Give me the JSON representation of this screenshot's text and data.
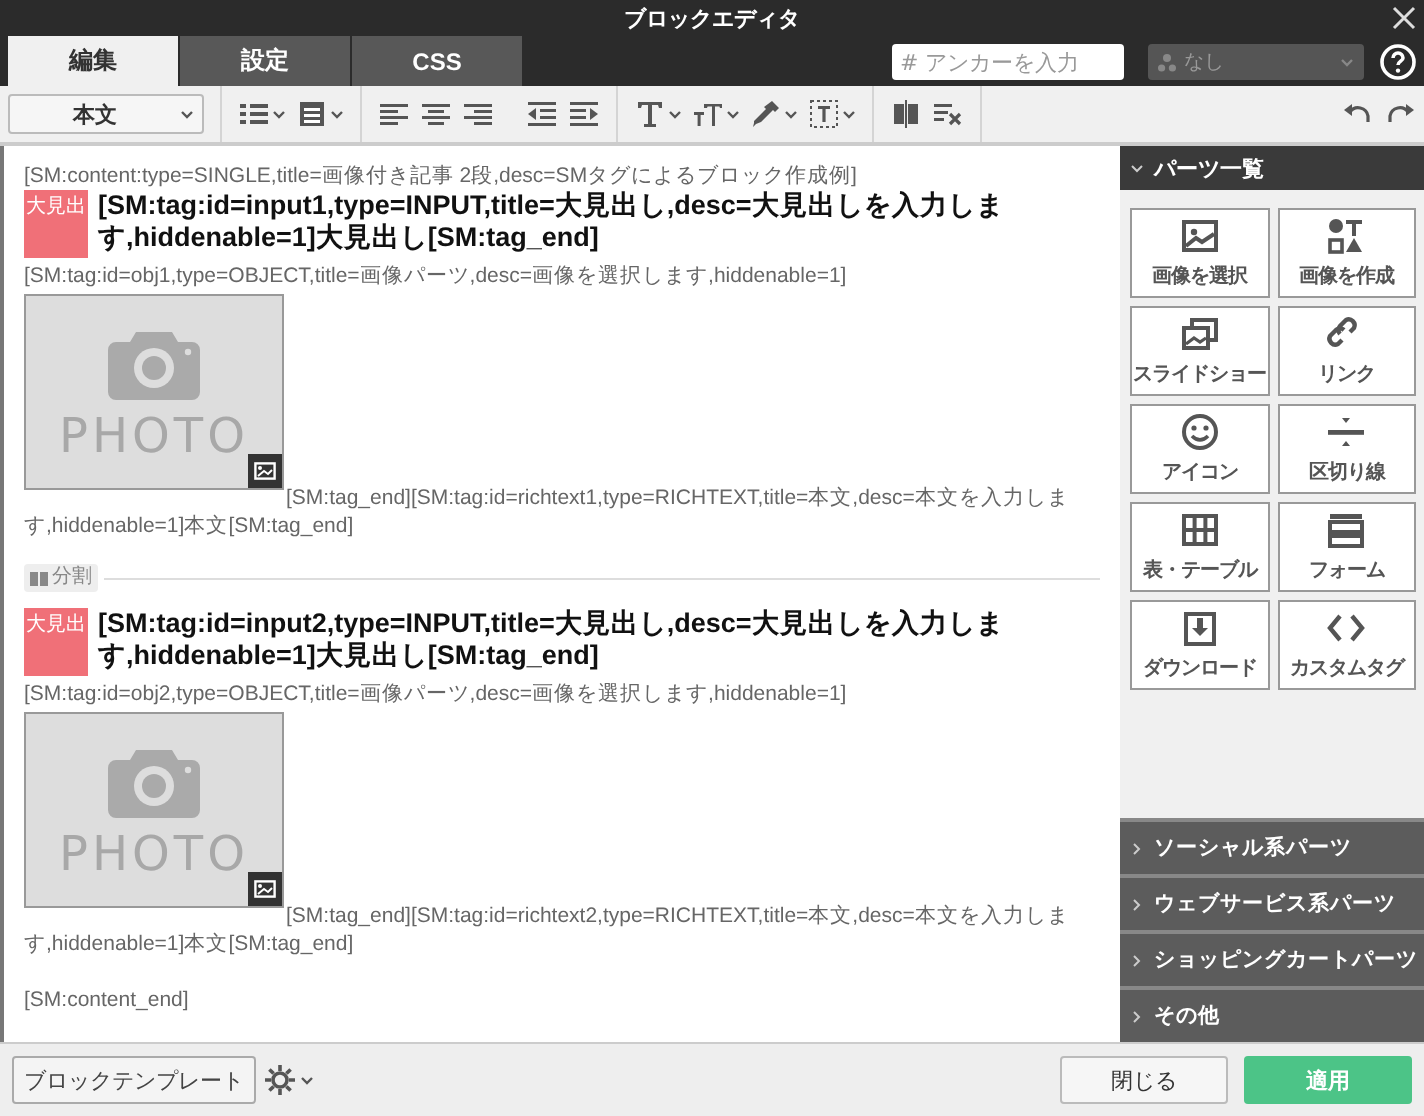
{
  "window": {
    "title": "ブロックエディタ"
  },
  "tabs": [
    {
      "label": "編集",
      "selected": true
    },
    {
      "label": "設定",
      "selected": false
    },
    {
      "label": "CSS",
      "selected": false
    }
  ],
  "anchor": {
    "placeholder": "# アンカーを入力"
  },
  "class_select": {
    "value": "なし",
    "disabled": true
  },
  "toolbar": {
    "style_select": "本文"
  },
  "editor": {
    "blocks": [
      {
        "kind": "tag",
        "text": "[SM:content:type=SINGLE,title=画像付き記事 2段,desc=SMタグによるブロック作成例]"
      },
      {
        "kind": "heading",
        "badge": "大見出",
        "text": "[SM:tag:id=input1,type=INPUT,title=大見出し,desc=大見出しを入力します,hiddenable=1]大見出し[SM:tag_end]"
      },
      {
        "kind": "tag",
        "text": "[SM:tag:id=obj1,type=OBJECT,title=画像パーツ,desc=画像を選択します,hiddenable=1]"
      },
      {
        "kind": "photo",
        "photo_label": "PHOTO",
        "text": "[SM:tag_end][SM:tag:id=richtext1,type=RICHTEXT,title=本文,desc=本文を入力します,hiddenable=1]本文[SM:tag_end]"
      },
      {
        "kind": "divider",
        "label": "分割"
      },
      {
        "kind": "heading",
        "badge": "大見出",
        "text": "[SM:tag:id=input2,type=INPUT,title=大見出し,desc=大見出しを入力します,hiddenable=1]大見出し[SM:tag_end]"
      },
      {
        "kind": "tag",
        "text": "[SM:tag:id=obj2,type=OBJECT,title=画像パーツ,desc=画像を選択します,hiddenable=1]"
      },
      {
        "kind": "photo",
        "photo_label": "PHOTO",
        "text": "[SM:tag_end][SM:tag:id=richtext2,type=RICHTEXT,title=本文,desc=本文を入力します,hiddenable=1]本文[SM:tag_end]"
      },
      {
        "kind": "tag",
        "text": "[SM:content_end]"
      }
    ]
  },
  "parts": {
    "title": "パーツ一覧",
    "expanded": true,
    "items": [
      "画像を選択",
      "画像を作成",
      "スライドショー",
      "リンク",
      "アイコン",
      "区切り線",
      "表・テーブル",
      "フォーム",
      "ダウンロード",
      "カスタムタグ"
    ]
  },
  "sections": [
    {
      "label": "ソーシャル系パーツ",
      "expanded": false
    },
    {
      "label": "ウェブサービス系パーツ",
      "expanded": false
    },
    {
      "label": "ショッピングカートパーツ",
      "expanded": false
    },
    {
      "label": "その他",
      "expanded": false
    }
  ],
  "footer": {
    "template_button": "ブロックテンプレート",
    "close_button": "閉じる",
    "apply_button": "適用"
  }
}
